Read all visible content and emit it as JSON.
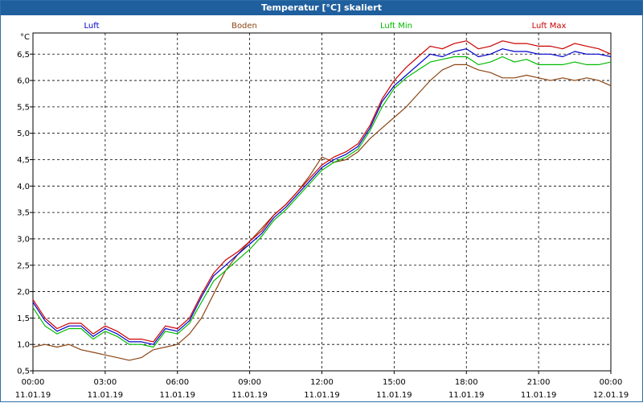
{
  "window": {
    "title": "Temperatur [°C] skaliert"
  },
  "chart_data": {
    "type": "line",
    "title": "Temperatur [°C] skaliert",
    "y_unit": "°C",
    "ylim": [
      0.5,
      6.9
    ],
    "y_ticks": [
      "0,5",
      "1,0",
      "1,5",
      "2,0",
      "2,5",
      "3,0",
      "3,5",
      "4,0",
      "4,5",
      "5,0",
      "5,5",
      "6,0",
      "6,5"
    ],
    "y_tick_values": [
      0.5,
      1.0,
      1.5,
      2.0,
      2.5,
      3.0,
      3.5,
      4.0,
      4.5,
      5.0,
      5.5,
      6.0,
      6.5
    ],
    "x_ticks": [
      {
        "time": "00:00",
        "date": "11.01.19"
      },
      {
        "time": "03:00",
        "date": "11.01.19"
      },
      {
        "time": "06:00",
        "date": "11.01.19"
      },
      {
        "time": "09:00",
        "date": "11.01.19"
      },
      {
        "time": "12:00",
        "date": "11.01.19"
      },
      {
        "time": "15:00",
        "date": "11.01.19"
      },
      {
        "time": "18:00",
        "date": "11.01.19"
      },
      {
        "time": "21:00",
        "date": "11.01.19"
      },
      {
        "time": "00:00",
        "date": "12.01.19"
      }
    ],
    "x_hours": [
      0,
      0.5,
      1,
      1.5,
      2,
      2.5,
      3,
      3.5,
      4,
      4.5,
      5,
      5.5,
      6,
      6.5,
      7,
      7.5,
      8,
      8.5,
      9,
      9.5,
      10,
      10.5,
      11,
      11.5,
      12,
      12.5,
      13,
      13.5,
      14,
      14.5,
      15,
      15.5,
      16,
      16.5,
      17,
      17.5,
      18,
      18.5,
      19,
      19.5,
      20,
      20.5,
      21,
      21.5,
      22,
      22.5,
      23,
      23.5,
      24
    ],
    "grid": true,
    "legend_position": "top",
    "series": [
      {
        "name": "Luft",
        "color": "#0000cc",
        "values": [
          1.8,
          1.45,
          1.25,
          1.35,
          1.35,
          1.15,
          1.3,
          1.2,
          1.05,
          1.05,
          1.0,
          1.3,
          1.25,
          1.45,
          1.9,
          2.3,
          2.5,
          2.7,
          2.9,
          3.1,
          3.4,
          3.6,
          3.85,
          4.1,
          4.35,
          4.5,
          4.6,
          4.75,
          5.1,
          5.6,
          5.9,
          6.1,
          6.3,
          6.5,
          6.45,
          6.55,
          6.6,
          6.45,
          6.5,
          6.6,
          6.55,
          6.55,
          6.5,
          6.5,
          6.45,
          6.55,
          6.5,
          6.5,
          6.45
        ]
      },
      {
        "name": "Boden",
        "color": "#8b4513",
        "values": [
          0.95,
          1.0,
          0.95,
          1.0,
          0.9,
          0.85,
          0.8,
          0.75,
          0.7,
          0.75,
          0.9,
          0.95,
          1.0,
          1.2,
          1.5,
          1.95,
          2.4,
          2.7,
          2.95,
          3.2,
          3.45,
          3.65,
          3.9,
          4.2,
          4.55,
          4.45,
          4.5,
          4.65,
          4.9,
          5.1,
          5.3,
          5.5,
          5.75,
          6.0,
          6.2,
          6.3,
          6.3,
          6.2,
          6.15,
          6.05,
          6.05,
          6.1,
          6.05,
          6.0,
          6.05,
          6.0,
          6.05,
          6.0,
          5.9
        ]
      },
      {
        "name": "Luft Min",
        "color": "#00bb00",
        "values": [
          1.7,
          1.35,
          1.2,
          1.3,
          1.3,
          1.1,
          1.25,
          1.15,
          1.0,
          1.0,
          0.95,
          1.25,
          1.2,
          1.4,
          1.8,
          2.2,
          2.4,
          2.6,
          2.8,
          3.05,
          3.35,
          3.55,
          3.8,
          4.05,
          4.3,
          4.45,
          4.55,
          4.7,
          5.05,
          5.5,
          5.85,
          6.05,
          6.2,
          6.35,
          6.4,
          6.45,
          6.45,
          6.3,
          6.35,
          6.45,
          6.35,
          6.4,
          6.3,
          6.3,
          6.3,
          6.35,
          6.3,
          6.3,
          6.35
        ]
      },
      {
        "name": "Luft Max",
        "color": "#cc0000",
        "values": [
          1.85,
          1.5,
          1.3,
          1.4,
          1.4,
          1.2,
          1.35,
          1.25,
          1.1,
          1.1,
          1.05,
          1.35,
          1.3,
          1.5,
          1.95,
          2.35,
          2.6,
          2.75,
          2.95,
          3.15,
          3.45,
          3.65,
          3.9,
          4.15,
          4.4,
          4.55,
          4.65,
          4.8,
          5.15,
          5.65,
          6.0,
          6.25,
          6.45,
          6.65,
          6.6,
          6.7,
          6.75,
          6.6,
          6.65,
          6.75,
          6.7,
          6.7,
          6.65,
          6.65,
          6.6,
          6.7,
          6.65,
          6.6,
          6.5
        ]
      }
    ]
  }
}
